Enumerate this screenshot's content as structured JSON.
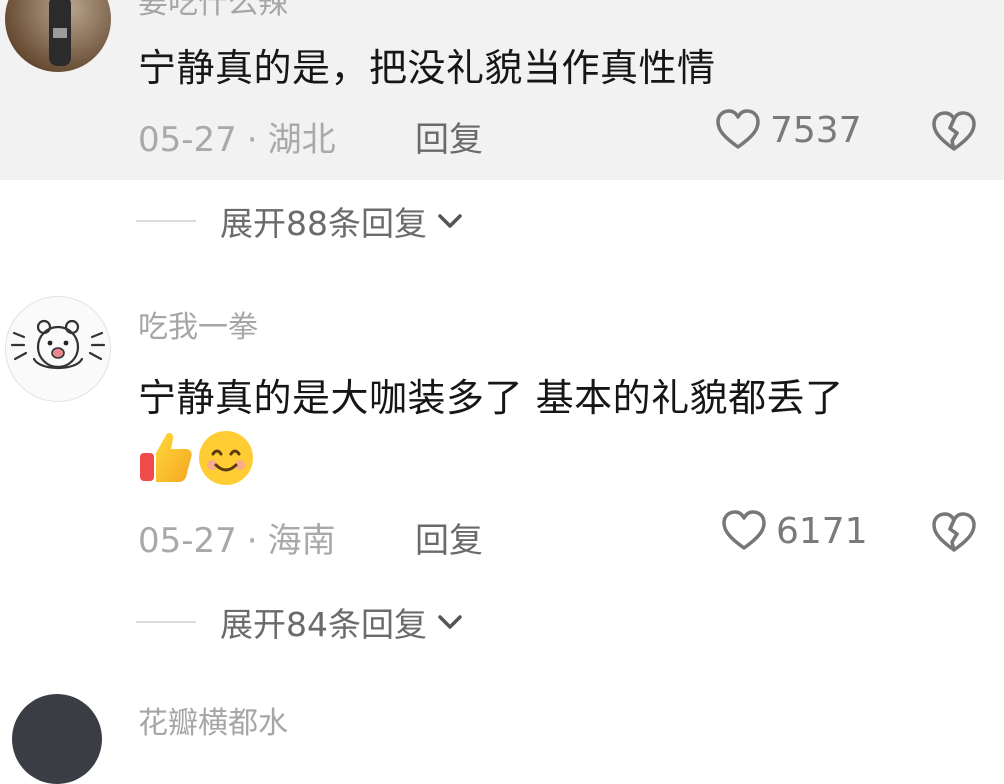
{
  "comments": [
    {
      "username": "要吃什么辣",
      "content": "宁静真的是，把没礼貌当作真性情",
      "date": "05-27",
      "location": "湖北",
      "reply_label": "回复",
      "likes": "7537",
      "expand_label": "展开88条回复"
    },
    {
      "username": "吃我一拳",
      "content": "宁静真的是大咖装多了 基本的礼貌都丢了",
      "emojis": [
        "thumbs-up",
        "smiling-face"
      ],
      "date": "05-27",
      "location": "海南",
      "reply_label": "回复",
      "likes": "6171",
      "expand_label": "展开84条回复"
    },
    {
      "username": "花瓣横都水"
    }
  ],
  "separator": "·",
  "colors": {
    "highlight_bg": "#f2f2f2",
    "meta_text": "#a9a9a9",
    "primary_text": "#161616"
  }
}
